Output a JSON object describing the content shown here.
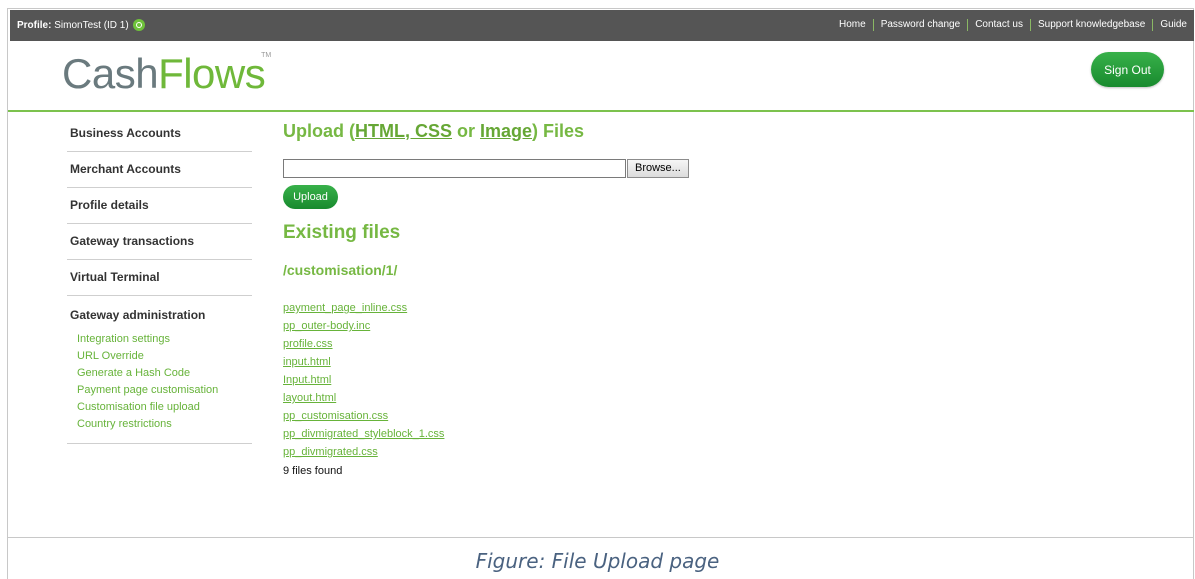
{
  "topbar": {
    "profile_label": "Profile:",
    "profile_value": "SimonTest (ID 1)",
    "links": [
      "Home",
      "Password change",
      "Contact us",
      "Support knowledgebase",
      "Guide"
    ]
  },
  "header": {
    "logo_part1": "Cash",
    "logo_part2": "Flows",
    "logo_tm": "TM",
    "signout_label": "Sign Out"
  },
  "sidebar": {
    "items": [
      "Business Accounts",
      "Merchant Accounts",
      "Profile details",
      "Gateway transactions",
      "Virtual Terminal"
    ],
    "group_title": "Gateway administration",
    "sub_items": [
      "Integration settings",
      "URL Override",
      "Generate a Hash Code",
      "Payment page customisation",
      "Customisation file upload",
      "Country restrictions"
    ]
  },
  "main": {
    "upload_title_prefix": "Upload (",
    "upload_title_html_css": "HTML, CSS",
    "upload_title_or": " or ",
    "upload_title_image": "Image",
    "upload_title_suffix": ") Files",
    "file_input_value": "",
    "browse_label": "Browse...",
    "upload_label": "Upload",
    "existing_title": "Existing files",
    "path": "/customisation/1/",
    "files": [
      "payment_page_inline.css",
      "pp_outer-body.inc",
      "profile.css",
      "input.html",
      "Input.html",
      "layout.html",
      "pp_customisation.css",
      "pp_divmigrated_styleblock_1.css",
      "pp_divmigrated.css"
    ],
    "files_found": "9 files found"
  },
  "caption": "Figure: File Upload page",
  "colors": {
    "accent_green": "#76b843",
    "button_green": "#209439",
    "topbar_grey": "#555555"
  }
}
